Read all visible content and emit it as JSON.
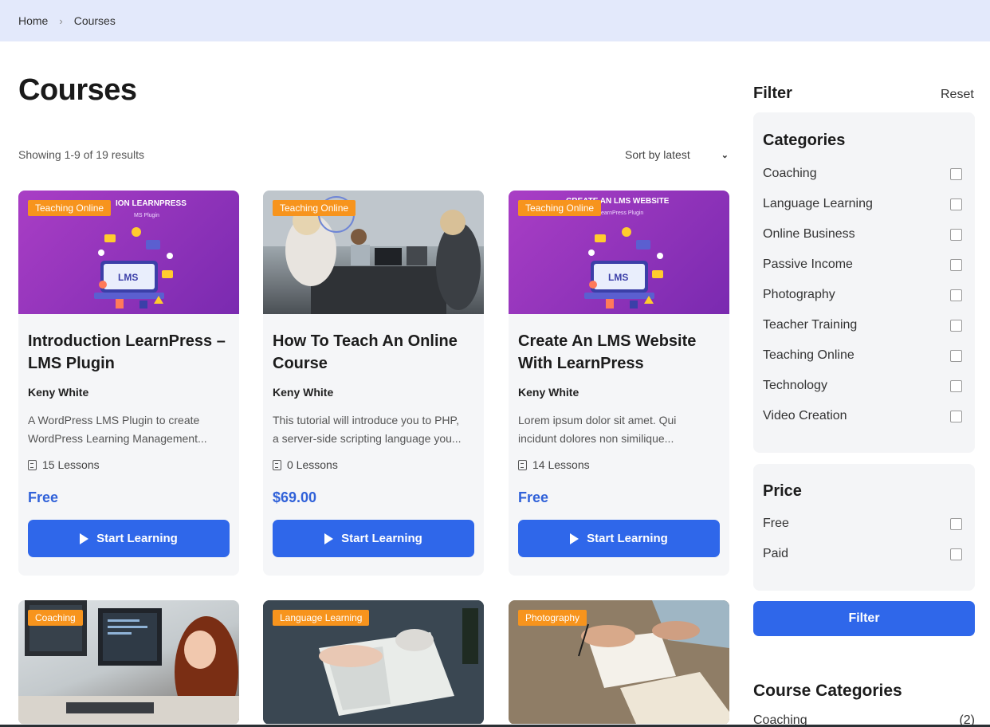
{
  "breadcrumb": {
    "home": "Home",
    "separator": "›",
    "current": "Courses"
  },
  "page": {
    "title": "Courses",
    "result_count": "Showing 1-9 of 19 results",
    "sort_label": "Sort by latest",
    "sort_icon": "chevron-down-icon"
  },
  "cards": [
    {
      "badge": "Teaching Online",
      "thumb_text_top": "ION LEARNPRESS",
      "thumb_text_sub": "MS Plugin",
      "thumb_logo": "LMS",
      "title": "Introduction LearnPress – LMS Plugin",
      "author": "Keny White",
      "desc_line1": "A WordPress LMS Plugin to create",
      "desc_line2": "WordPress Learning Management...",
      "lessons": "15 Lessons",
      "price": "Free",
      "button": "Start Learning"
    },
    {
      "badge": "Teaching Online",
      "title": "How To Teach An Online Course",
      "author": "Keny White",
      "desc_line1": "This tutorial will introduce you to PHP,",
      "desc_line2": "a server-side scripting language you...",
      "lessons": "0 Lessons",
      "price": "$69.00",
      "button": "Start Learning"
    },
    {
      "badge": "Teaching Online",
      "thumb_text_top": "CREATE AN LMS WEBSITE",
      "thumb_text_sub": "earnPress Plugin",
      "thumb_logo": "LMS",
      "title": "Create An LMS Website With LearnPress",
      "author": "Keny White",
      "desc_line1": "Lorem ipsum dolor sit amet. Qui",
      "desc_line2": "incidunt dolores non similique...",
      "lessons": "14 Lessons",
      "price": "Free",
      "button": "Start Learning"
    },
    {
      "badge": "Coaching"
    },
    {
      "badge": "Language Learning"
    },
    {
      "badge": "Photography"
    }
  ],
  "filter": {
    "heading": "Filter",
    "reset": "Reset",
    "categories_heading": "Categories",
    "categories": [
      "Coaching",
      "Language Learning",
      "Online Business",
      "Passive Income",
      "Photography",
      "Teacher Training",
      "Teaching Online",
      "Technology",
      "Video Creation"
    ],
    "price_heading": "Price",
    "prices": [
      "Free",
      "Paid"
    ],
    "button": "Filter"
  },
  "course_categories": {
    "heading": "Course Categories",
    "first_item": "Coaching",
    "first_count": "(2)"
  },
  "colors": {
    "accent": "#2f67ea",
    "badge": "#f7941d",
    "price": "#3162d9",
    "breadcrumb_bg": "#e3e9fb"
  }
}
